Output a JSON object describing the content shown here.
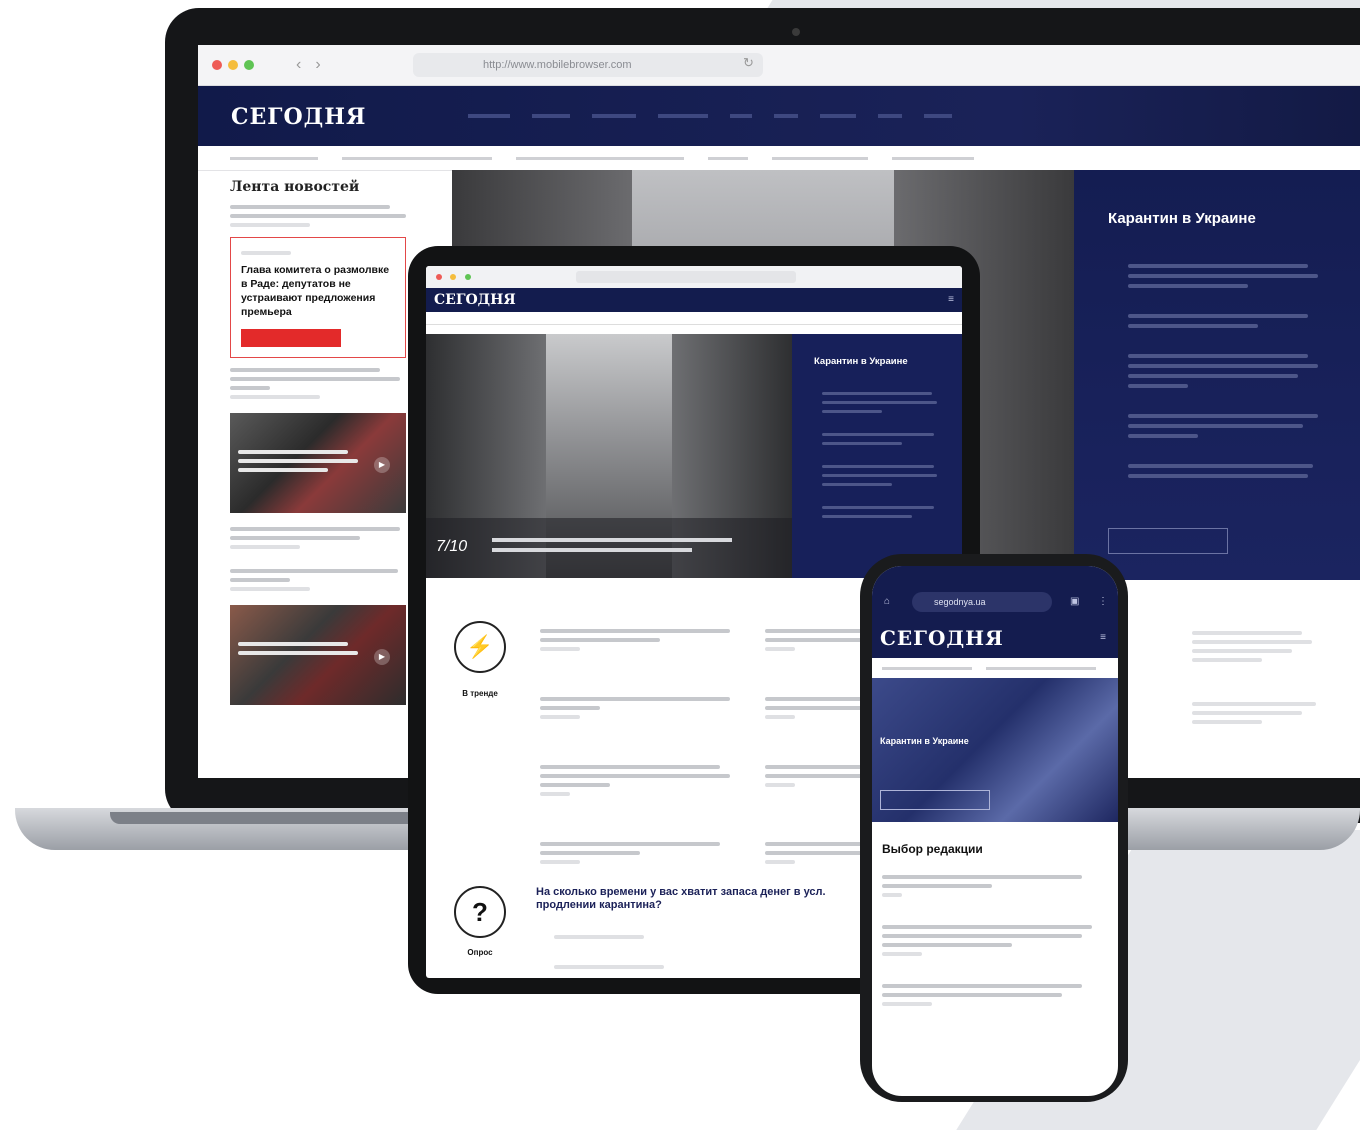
{
  "laptop": {
    "browser": {
      "url": "http://www.mobilebrowser.com"
    },
    "header": {
      "logo": "СЕГОДНЯ"
    },
    "feed": {
      "title": "Лента новостей",
      "highlight_card": "Глава комитета о размолвке в Раде: депутатов не устраивают предложения премьера"
    },
    "panel": {
      "title": "Карантин в Украине"
    }
  },
  "tablet": {
    "header": {
      "logo": "СЕГОДНЯ"
    },
    "hero": {
      "counter": "7/10"
    },
    "panel": {
      "title": "Карантин в Украине"
    },
    "sections": {
      "trend_label": "В тренде",
      "poll_label": "Опрос",
      "poll_question": "На сколько времени у вас хватит запаса денег в усл. продлении карантина?"
    }
  },
  "phone": {
    "url": "segodnya.ua",
    "logo": "СЕГОДНЯ",
    "hero_title": "Карантин в Украине",
    "editor_title": "Выбор редакции"
  }
}
